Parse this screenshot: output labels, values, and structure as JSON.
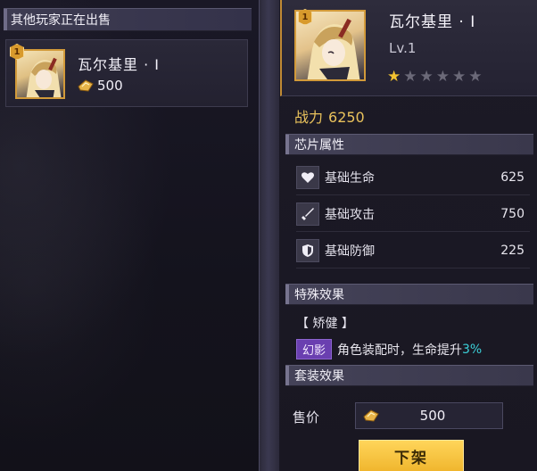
{
  "market": {
    "header": "其他玩家正在出售",
    "listing": {
      "name": "瓦尔基里 · Ⅰ",
      "rank": "1",
      "price": "500"
    }
  },
  "detail": {
    "rank": "1",
    "name": "瓦尔基里 · Ⅰ",
    "level": "Lv.1",
    "stars": {
      "lit": 1,
      "total": 6
    },
    "power_label": "战力",
    "power_value": "6250",
    "chip_section": "芯片属性",
    "stats": [
      {
        "icon": "heart-icon",
        "label": "基础生命",
        "value": "625"
      },
      {
        "icon": "sword-icon",
        "label": "基础攻击",
        "value": "750"
      },
      {
        "icon": "shield-icon",
        "label": "基础防御",
        "value": "225"
      }
    ],
    "special_section": "特殊效果",
    "special_name": "【 矫健 】",
    "special_tag": "幻影",
    "special_text": "角色装配时，生命提升",
    "special_pct": "3%",
    "set_section": "套装效果",
    "sale_label": "售价",
    "sale_price": "500",
    "unlist_button": "下架"
  },
  "colors": {
    "gold_accent": "#d29a3a",
    "power_text": "#e9c25c",
    "star_on": "#f2c230",
    "effect_tag": "#6a3fb0",
    "effect_pct": "#3bd0d8",
    "button_yellow": "#f0b62e"
  }
}
